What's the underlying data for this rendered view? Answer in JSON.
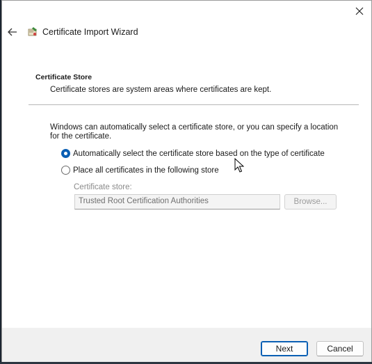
{
  "window": {
    "title": "Certificate Import Wizard"
  },
  "page": {
    "heading": "Certificate Store",
    "subheading": "Certificate stores are system areas where certificates are kept."
  },
  "body": {
    "intro": "Windows can automatically select a certificate store, or you can specify a location for the certificate.",
    "options": [
      {
        "label": "Automatically select the certificate store based on the type of certificate",
        "selected": true
      },
      {
        "label": "Place all certificates in the following store",
        "selected": false
      }
    ],
    "store_label": "Certificate store:",
    "store_value": "Trusted Root Certification Authorities",
    "browse_label": "Browse..."
  },
  "footer": {
    "next_label": "Next",
    "cancel_label": "Cancel"
  },
  "icons": {
    "close": "close-icon",
    "back": "back-arrow-icon",
    "app": "certificate-icon"
  },
  "colors": {
    "accent": "#0a5fb4"
  }
}
